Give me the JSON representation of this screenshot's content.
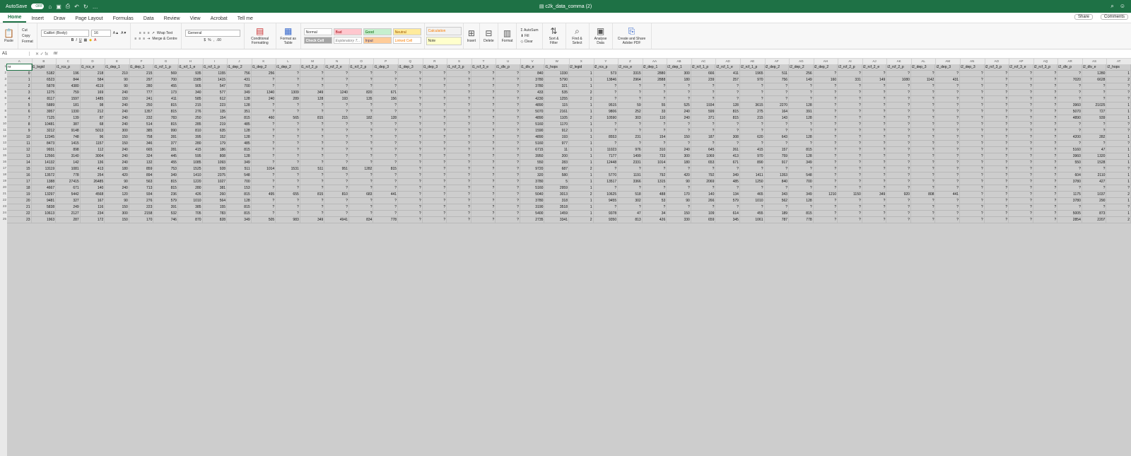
{
  "titlebar": {
    "autosave": "AutoSave",
    "autosave_state": "OFF",
    "doc_title": "c2k_data_comma (2)"
  },
  "tabs": [
    "Home",
    "Insert",
    "Draw",
    "Page Layout",
    "Formulas",
    "Data",
    "Review",
    "View",
    "Acrobat",
    "Tell me"
  ],
  "share": "Share",
  "comments": "Comments",
  "ribbon": {
    "paste": "Paste",
    "cut": "Cut",
    "copy": "Copy",
    "format": "Format",
    "font": "Calibri (Body)",
    "size": "16",
    "wrap": "Wrap Text",
    "merge": "Merge & Centre",
    "numfmt": "General",
    "cond": "Conditional Formatting",
    "table": "Format as Table",
    "styles": [
      "Normal",
      "Bad",
      "Good",
      "Neutral",
      "Calculation",
      "Check Cell",
      "Explanatory T...",
      "Input",
      "Linked Cell",
      "Note"
    ],
    "insert": "Insert",
    "delete": "Delete",
    "formatc": "Format",
    "autosum": "AutoSum",
    "fill": "Fill",
    "clear": "Clear",
    "sort": "Sort & Filter",
    "find": "Find & Select",
    "analyse": "Analyse Data",
    "pdf": "Create and Share Adobe PDF"
  },
  "formula": {
    "cell": "A1",
    "value": "nr"
  },
  "columns": [
    "A",
    "B",
    "C",
    "D",
    "E",
    "F",
    "G",
    "H",
    "I",
    "J",
    "K",
    "L",
    "M",
    "N",
    "O",
    "P",
    "Q",
    "R",
    "S",
    "T",
    "U",
    "V",
    "W",
    "X",
    "Y",
    "Z",
    "AA",
    "AB",
    "AC",
    "AD",
    "AE",
    "AF",
    "AG",
    "AH",
    "AI",
    "AJ",
    "AK",
    "AL",
    "AM",
    "AN",
    "AO",
    "AP",
    "AQ",
    "AR",
    "AS",
    "AT",
    "AU",
    "AV",
    "AW"
  ],
  "header": [
    "nr",
    "i1_legid",
    "i1_rcs_p",
    "i1_rcs_e",
    "i1_dep_1",
    "i1_dep_1",
    "i1_rcf_1_p",
    "i1_rcf_1_e",
    "i1_rcf_1_p",
    "i1_dep_2",
    "i1_dep_2",
    "i1_dep_2",
    "i1_rcf_2_p",
    "i1_rcf_2_e",
    "i1_rcf_2_p",
    "i1_dep_3",
    "i1_dep_3",
    "i1_dep_3",
    "i1_rcf_3_p",
    "i1_rcf_3_e",
    "i1_dlv_p",
    "i1_dlv_e",
    "i1_hops",
    "i2_legid",
    "i2_rcs_p",
    "i2_rcs_e",
    "i2_dep_1",
    "i2_dep_1",
    "i2_rcf_1_p",
    "i2_rcf_1_e",
    "i2_rcf_1_p",
    "i2_dep_2",
    "i2_dep_2",
    "i2_dep_2",
    "i2_rcf_2_p",
    "i2_rcf_2_e",
    "i2_rcf_2_p",
    "i2_dep_3",
    "i2_dep_3",
    "i2_dep_3",
    "i2_rcf_3_p",
    "i2_rcf_3_e",
    "i2_rcf_3_p",
    "i2_dlv_p",
    "i2_dlv_e",
    "i2_hops"
  ],
  "rows": [
    [
      "0",
      "5182",
      "196",
      "218",
      "210",
      "215",
      "569",
      "935",
      "1155",
      "756",
      "256",
      "?",
      "?",
      "?",
      "?",
      "?",
      "?",
      "?",
      "?",
      "?",
      "?",
      "840",
      "1330",
      "1",
      "573",
      "3315",
      "2880",
      "300",
      "666",
      "411",
      "1965",
      "511",
      "256",
      "?",
      "?",
      "?",
      "?",
      "?",
      "?",
      "?",
      "?",
      "?",
      "?",
      "?",
      "1280",
      "1"
    ],
    [
      "1",
      "6523",
      "844",
      "584",
      "90",
      "297",
      "700",
      "1585",
      "1415",
      "431",
      "?",
      "?",
      "?",
      "?",
      "?",
      "?",
      "?",
      "?",
      "?",
      "?",
      "?",
      "3780",
      "5790",
      "1",
      "13846",
      "2964",
      "2888",
      "180",
      "239",
      "257",
      "970",
      "756",
      "149",
      "160",
      "331",
      "149",
      "1080",
      "1142",
      "431",
      "?",
      "?",
      "?",
      "?",
      "7020",
      "6628",
      "2"
    ],
    [
      "2",
      "5878",
      "4380",
      "4119",
      "90",
      "280",
      "455",
      "905",
      "547",
      "700",
      "?",
      "?",
      "?",
      "?",
      "?",
      "?",
      "?",
      "?",
      "?",
      "?",
      "?",
      "3780",
      "321",
      "1",
      "?",
      "?",
      "?",
      "?",
      "?",
      "?",
      "?",
      "?",
      "?",
      "?",
      "?",
      "?",
      "?",
      "?",
      "?",
      "?",
      "?",
      "?",
      "?",
      "?",
      "?",
      "?"
    ],
    [
      "3",
      "1275",
      "759",
      "169",
      "240",
      "777",
      "173",
      "340",
      "577",
      "349",
      "1340",
      "1309",
      "349",
      "1240",
      "820",
      "671",
      "?",
      "?",
      "?",
      "?",
      "?",
      "433",
      "535",
      "2",
      "?",
      "?",
      "?",
      "?",
      "?",
      "?",
      "?",
      "?",
      "?",
      "?",
      "?",
      "?",
      "?",
      "?",
      "?",
      "?",
      "?",
      "?",
      "?",
      "?",
      "?",
      "?"
    ],
    [
      "4",
      "8117",
      "1597",
      "1485",
      "150",
      "241",
      "411",
      "585",
      "612",
      "128",
      "240",
      "289",
      "128",
      "193",
      "135",
      "156",
      "?",
      "?",
      "?",
      "?",
      "?",
      "4230",
      "1255",
      "2",
      "?",
      "?",
      "?",
      "?",
      "?",
      "?",
      "?",
      "?",
      "?",
      "?",
      "?",
      "?",
      "?",
      "?",
      "?",
      "?",
      "?",
      "?",
      "?",
      "?",
      "?",
      "?"
    ],
    [
      "5",
      "5889",
      "181",
      "98",
      "240",
      "250",
      "815",
      "215",
      "223",
      "128",
      "?",
      "?",
      "?",
      "?",
      "?",
      "?",
      "?",
      "?",
      "?",
      "?",
      "?",
      "4890",
      "115",
      "1",
      "9515",
      "59",
      "55",
      "525",
      "1934",
      "128",
      "3615",
      "2270",
      "128",
      "?",
      "?",
      "?",
      "?",
      "?",
      "?",
      "?",
      "?",
      "?",
      "?",
      "3960",
      "21025",
      "1"
    ],
    [
      "6",
      "3957",
      "1330",
      "212",
      "240",
      "1357",
      "815",
      "276",
      "135",
      "351",
      "?",
      "?",
      "?",
      "?",
      "?",
      "?",
      "?",
      "?",
      "?",
      "?",
      "?",
      "5070",
      "2161",
      "1",
      "9806",
      "252",
      "33",
      "240",
      "599",
      "815",
      "275",
      "164",
      "391",
      "?",
      "?",
      "?",
      "?",
      "?",
      "?",
      "?",
      "?",
      "?",
      "?",
      "5070",
      "727",
      "1"
    ],
    [
      "7",
      "7125",
      "139",
      "87",
      "240",
      "232",
      "783",
      "250",
      "154",
      "815",
      "460",
      "565",
      "815",
      "215",
      "182",
      "128",
      "?",
      "?",
      "?",
      "?",
      "?",
      "4890",
      "1105",
      "2",
      "10590",
      "303",
      "110",
      "240",
      "371",
      "815",
      "215",
      "143",
      "128",
      "?",
      "?",
      "?",
      "?",
      "?",
      "?",
      "?",
      "?",
      "?",
      "?",
      "4890",
      "939",
      "1"
    ],
    [
      "8",
      "10481",
      "387",
      "68",
      "240",
      "514",
      "815",
      "285",
      "219",
      "485",
      "?",
      "?",
      "?",
      "?",
      "?",
      "?",
      "?",
      "?",
      "?",
      "?",
      "?",
      "5160",
      "1170",
      "1",
      "?",
      "?",
      "?",
      "?",
      "?",
      "?",
      "?",
      "?",
      "?",
      "?",
      "?",
      "?",
      "?",
      "?",
      "?",
      "?",
      "?",
      "?",
      "?",
      "?",
      "?",
      "?"
    ],
    [
      "9",
      "3212",
      "9148",
      "5013",
      "300",
      "385",
      "990",
      "810",
      "635",
      "128",
      "?",
      "?",
      "?",
      "?",
      "?",
      "?",
      "?",
      "?",
      "?",
      "?",
      "?",
      "1590",
      "912",
      "1",
      "?",
      "?",
      "?",
      "?",
      "?",
      "?",
      "?",
      "?",
      "?",
      "?",
      "?",
      "?",
      "?",
      "?",
      "?",
      "?",
      "?",
      "?",
      "?",
      "?",
      "?",
      "?"
    ],
    [
      "10",
      "12345",
      "748",
      "96",
      "150",
      "758",
      "281",
      "395",
      "152",
      "128",
      "?",
      "?",
      "?",
      "?",
      "?",
      "?",
      "?",
      "?",
      "?",
      "?",
      "?",
      "4890",
      "193",
      "1",
      "8553",
      "231",
      "154",
      "150",
      "187",
      "308",
      "620",
      "643",
      "128",
      "?",
      "?",
      "?",
      "?",
      "?",
      "?",
      "?",
      "?",
      "?",
      "?",
      "4200",
      "282",
      "1"
    ],
    [
      "11",
      "8473",
      "1415",
      "1157",
      "150",
      "346",
      "377",
      "280",
      "179",
      "485",
      "?",
      "?",
      "?",
      "?",
      "?",
      "?",
      "?",
      "?",
      "?",
      "?",
      "?",
      "5160",
      "977",
      "1",
      "?",
      "?",
      "?",
      "?",
      "?",
      "?",
      "?",
      "?",
      "?",
      "?",
      "?",
      "?",
      "?",
      "?",
      "?",
      "?",
      "?",
      "?",
      "?",
      "?",
      "?",
      "?"
    ],
    [
      "12",
      "9931",
      "898",
      "112",
      "240",
      "665",
      "281",
      "415",
      "186",
      "815",
      "?",
      "?",
      "?",
      "?",
      "?",
      "?",
      "?",
      "?",
      "?",
      "?",
      "?",
      "6715",
      "11",
      "1",
      "11023",
      "976",
      "310",
      "240",
      "645",
      "261",
      "415",
      "157",
      "815",
      "?",
      "?",
      "?",
      "?",
      "?",
      "?",
      "?",
      "?",
      "?",
      "?",
      "5160",
      "47",
      "1"
    ],
    [
      "13",
      "12566",
      "3140",
      "3004",
      "240",
      "324",
      "445",
      "595",
      "808",
      "128",
      "?",
      "?",
      "?",
      "?",
      "?",
      "?",
      "?",
      "?",
      "?",
      "?",
      "?",
      "3950",
      "200",
      "1",
      "7177",
      "1499",
      "733",
      "300",
      "1069",
      "413",
      "970",
      "759",
      "128",
      "?",
      "?",
      "?",
      "?",
      "?",
      "?",
      "?",
      "?",
      "?",
      "?",
      "3960",
      "1320",
      "1"
    ],
    [
      "14",
      "14132",
      "142",
      "136",
      "240",
      "132",
      "455",
      "1085",
      "1093",
      "349",
      "?",
      "?",
      "?",
      "?",
      "?",
      "?",
      "?",
      "?",
      "?",
      "?",
      "?",
      "550",
      "283",
      "1",
      "12448",
      "2331",
      "1014",
      "180",
      "653",
      "671",
      "890",
      "917",
      "349",
      "?",
      "?",
      "?",
      "?",
      "?",
      "?",
      "?",
      "?",
      "?",
      "?",
      "550",
      "1528",
      "1"
    ],
    [
      "15",
      "13119",
      "1081",
      "413",
      "180",
      "859",
      "753",
      "1525",
      "928",
      "511",
      "1014",
      "1531",
      "511",
      "951",
      "1282",
      "815",
      "?",
      "?",
      "?",
      "?",
      "?",
      "9720",
      "687",
      "2",
      "?",
      "?",
      "?",
      "?",
      "?",
      "?",
      "?",
      "?",
      "?",
      "?",
      "?",
      "?",
      "?",
      "?",
      "?",
      "?",
      "?",
      "?",
      "?",
      "?",
      "?",
      "?"
    ],
    [
      "16",
      "13572",
      "778",
      "254",
      "420",
      "894",
      "349",
      "1410",
      "2375",
      "548",
      "?",
      "?",
      "?",
      "?",
      "?",
      "?",
      "?",
      "?",
      "?",
      "?",
      "?",
      "320",
      "580",
      "1",
      "5770",
      "1191",
      "792",
      "420",
      "792",
      "349",
      "1411",
      "1353",
      "548",
      "?",
      "?",
      "?",
      "?",
      "?",
      "?",
      "?",
      "?",
      "?",
      "?",
      "604",
      "2110",
      "1"
    ],
    [
      "17",
      "1388",
      "27415",
      "26485",
      "90",
      "563",
      "815",
      "1220",
      "1027",
      "700",
      "?",
      "?",
      "?",
      "?",
      "?",
      "?",
      "?",
      "?",
      "?",
      "?",
      "?",
      "3780",
      "5",
      "1",
      "13517",
      "3366",
      "1315",
      "90",
      "2069",
      "485",
      "1250",
      "840",
      "700",
      "?",
      "?",
      "?",
      "?",
      "?",
      "?",
      "?",
      "?",
      "?",
      "?",
      "3780",
      "427",
      "1"
    ],
    [
      "18",
      "4667",
      "671",
      "140",
      "240",
      "713",
      "815",
      "280",
      "381",
      "153",
      "?",
      "?",
      "?",
      "?",
      "?",
      "?",
      "?",
      "?",
      "?",
      "?",
      "?",
      "5160",
      "2959",
      "1",
      "?",
      "?",
      "?",
      "?",
      "?",
      "?",
      "?",
      "?",
      "?",
      "?",
      "?",
      "?",
      "?",
      "?",
      "?",
      "?",
      "?",
      "?",
      "?",
      "?",
      "?",
      "?"
    ],
    [
      "19",
      "13297",
      "5442",
      "4568",
      "120",
      "934",
      "236",
      "426",
      "260",
      "815",
      "495",
      "655",
      "815",
      "810",
      "683",
      "441",
      "?",
      "?",
      "?",
      "?",
      "?",
      "5040",
      "3013",
      "2",
      "10625",
      "518",
      "488",
      "170",
      "140",
      "134",
      "465",
      "343",
      "349",
      "1210",
      "1150",
      "349",
      "920",
      "808",
      "441",
      "?",
      "?",
      "?",
      "?",
      "1175",
      "1037",
      "2"
    ],
    [
      "20",
      "9481",
      "327",
      "167",
      "90",
      "276",
      "579",
      "1010",
      "564",
      "128",
      "?",
      "?",
      "?",
      "?",
      "?",
      "?",
      "?",
      "?",
      "?",
      "?",
      "?",
      "3780",
      "318",
      "1",
      "9455",
      "302",
      "53",
      "90",
      "266",
      "579",
      "1010",
      "562",
      "128",
      "?",
      "?",
      "?",
      "?",
      "?",
      "?",
      "?",
      "?",
      "?",
      "?",
      "3780",
      "290",
      "1"
    ],
    [
      "21",
      "5838",
      "249",
      "116",
      "150",
      "223",
      "391",
      "385",
      "155",
      "815",
      "?",
      "?",
      "?",
      "?",
      "?",
      "?",
      "?",
      "?",
      "?",
      "?",
      "?",
      "3190",
      "3518",
      "1",
      "?",
      "?",
      "?",
      "?",
      "?",
      "?",
      "?",
      "?",
      "?",
      "?",
      "?",
      "?",
      "?",
      "?",
      "?",
      "?",
      "?",
      "?",
      "?",
      "?",
      "?",
      "?"
    ],
    [
      "22",
      "10613",
      "2127",
      "234",
      "300",
      "2158",
      "532",
      "705",
      "783",
      "815",
      "?",
      "?",
      "?",
      "?",
      "?",
      "?",
      "?",
      "?",
      "?",
      "?",
      "?",
      "5400",
      "1459",
      "1",
      "9378",
      "47",
      "34",
      "150",
      "109",
      "614",
      "455",
      "189",
      "815",
      "?",
      "?",
      "?",
      "?",
      "?",
      "?",
      "?",
      "?",
      "?",
      "?",
      "5005",
      "873",
      "1"
    ],
    [
      "23",
      "1963",
      "287",
      "172",
      "150",
      "170",
      "746",
      "870",
      "828",
      "349",
      "505",
      "983",
      "349",
      "4941",
      "834",
      "778",
      "?",
      "?",
      "?",
      "?",
      "?",
      "2735",
      "3341",
      "2",
      "9350",
      "813",
      "426",
      "330",
      "659",
      "345",
      "1061",
      "787",
      "778",
      "?",
      "?",
      "?",
      "?",
      "?",
      "?",
      "?",
      "?",
      "?",
      "?",
      "2854",
      "2207",
      "2"
    ]
  ]
}
